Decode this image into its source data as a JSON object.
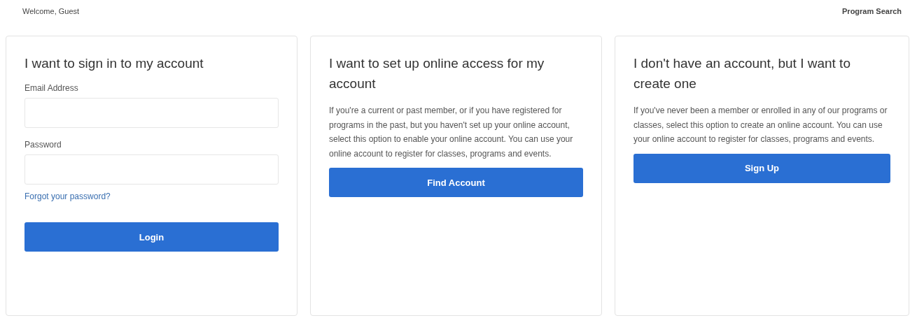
{
  "header": {
    "welcome": "Welcome, Guest",
    "link": "Program Search"
  },
  "cards": [
    {
      "kind": "login",
      "title": "I want to sign in to my account",
      "fields": [
        {
          "label": "Email Address"
        },
        {
          "label": "Password"
        }
      ],
      "link": "Forgot your password?",
      "button": "Login"
    },
    {
      "kind": "info",
      "title": "I want to set up online access for my account",
      "text": "If you're a current or past member, or if you have registered for programs in the past, but you haven't set up your online account, select this option to enable your online account. You can use your online account to register for classes, programs and events.",
      "button": "Find Account"
    },
    {
      "kind": "info",
      "title": "I don't have an account, but I want to create one",
      "text": "If you've never been a member or enrolled in any of our programs or classes, select this option to create an online account. You can use your online account to register for classes, programs and events.",
      "button": "Sign Up"
    }
  ]
}
